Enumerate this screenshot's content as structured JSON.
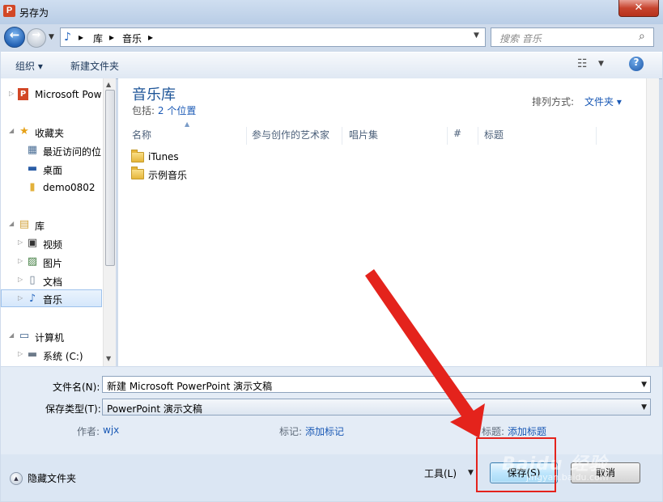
{
  "window": {
    "title": "另存为",
    "app_icon_letter": "P",
    "close_glyph": "✕"
  },
  "address": {
    "crumbs": [
      "库",
      "音乐"
    ],
    "separator": "▸",
    "search_placeholder": "搜索 音乐"
  },
  "toolbar": {
    "organize": "组织 ▾",
    "new_folder": "新建文件夹"
  },
  "nav": {
    "items": [
      {
        "label": "Microsoft Pow",
        "icon": "powerpoint-icon"
      },
      {
        "label": "收藏夹",
        "icon": "star-icon"
      },
      {
        "label": "最近访问的位",
        "icon": "recent-icon"
      },
      {
        "label": "桌面",
        "icon": "desktop-icon"
      },
      {
        "label": "demo0802",
        "icon": "folder-icon"
      },
      {
        "label": "库",
        "icon": "library-icon"
      },
      {
        "label": "视频",
        "icon": "video-icon"
      },
      {
        "label": "图片",
        "icon": "picture-icon"
      },
      {
        "label": "文档",
        "icon": "document-icon"
      },
      {
        "label": "音乐",
        "icon": "music-icon",
        "selected": true
      },
      {
        "label": "计算机",
        "icon": "computer-icon"
      },
      {
        "label": "系统 (C:)",
        "icon": "drive-icon"
      }
    ]
  },
  "library": {
    "title": "音乐库",
    "includes_label": "包括:",
    "includes_link": "2 个位置",
    "arrange_label": "排列方式:",
    "arrange_value": "文件夹 ▾"
  },
  "columns": [
    "名称",
    "参与创作的艺术家",
    "唱片集",
    "#",
    "标题"
  ],
  "files": [
    {
      "name": "iTunes"
    },
    {
      "name": "示例音乐"
    }
  ],
  "form": {
    "filename_label": "文件名(N):",
    "filename_value": "新建 Microsoft PowerPoint 演示文稿",
    "filetype_label": "保存类型(T):",
    "filetype_value": "PowerPoint 演示文稿",
    "author_label": "作者:",
    "author_value": "wjx",
    "tags_label": "标记:",
    "tags_value": "添加标记",
    "title_label": "标题:",
    "title_value": "添加标题"
  },
  "buttons": {
    "hide_folders": "隐藏文件夹",
    "tools": "工具(L)",
    "save": "保存(S)",
    "cancel": "取消"
  },
  "annotation": {
    "color": "#e4231c"
  },
  "watermark": {
    "text": "Baidu 经验",
    "url": "jingyan.baidu.com"
  }
}
